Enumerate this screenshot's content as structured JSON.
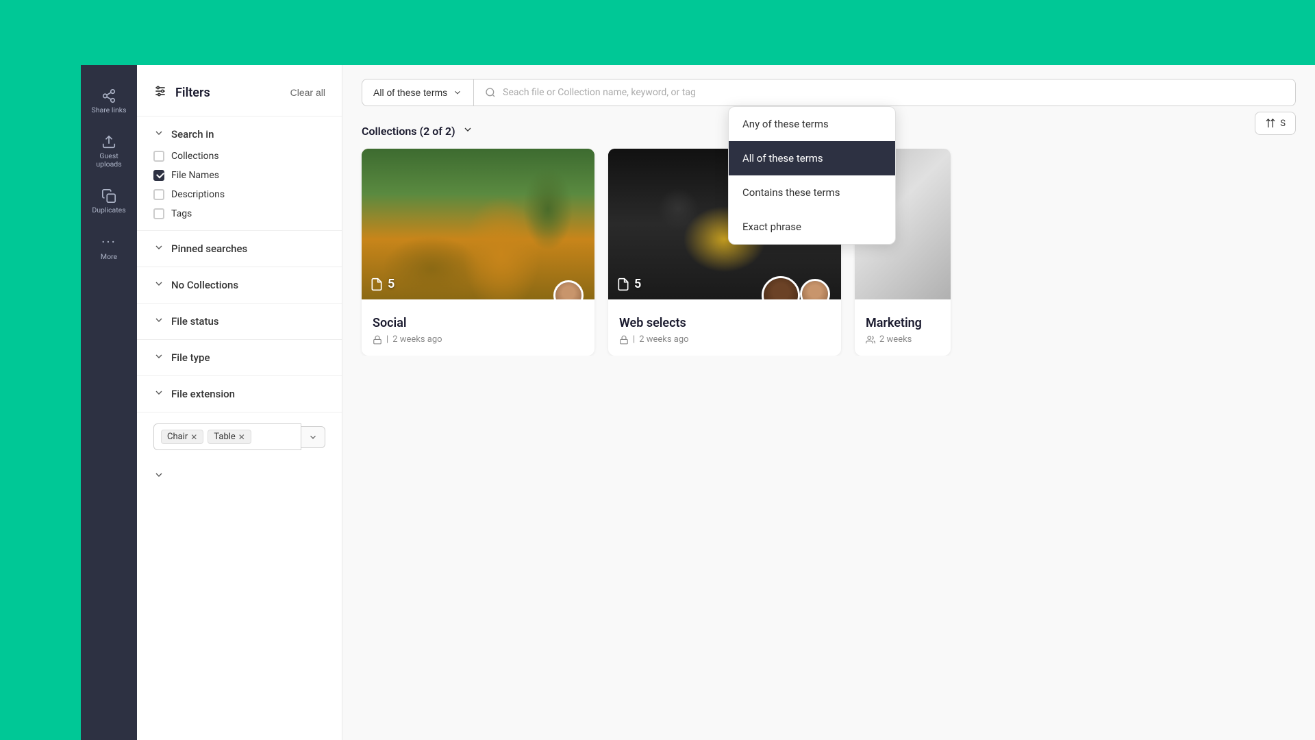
{
  "app": {
    "background_color": "#00c896"
  },
  "nav": {
    "items": [
      {
        "id": "share-links",
        "label": "Share links",
        "icon": "share-icon"
      },
      {
        "id": "guest-uploads",
        "label": "Guest uploads",
        "icon": "upload-icon"
      },
      {
        "id": "duplicates",
        "label": "Duplicates",
        "icon": "copy-icon"
      },
      {
        "id": "more",
        "label": "More",
        "icon": "dots-icon"
      }
    ]
  },
  "filters": {
    "title": "Filters",
    "clear_all": "Clear all",
    "sections": {
      "search_in": {
        "label": "Search in",
        "expanded": true,
        "options": [
          {
            "id": "collections",
            "label": "Collections",
            "checked": false
          },
          {
            "id": "file-names",
            "label": "File Names",
            "checked": true
          },
          {
            "id": "descriptions",
            "label": "Descriptions",
            "checked": false
          },
          {
            "id": "tags",
            "label": "Tags",
            "checked": false
          }
        ]
      },
      "pinned_searches": {
        "label": "Pinned searches",
        "expanded": false
      },
      "no_collections": {
        "label": "No Collections",
        "expanded": false
      },
      "file_status": {
        "label": "File status",
        "expanded": false
      },
      "file_type": {
        "label": "File type",
        "expanded": false
      },
      "file_extension": {
        "label": "File extension",
        "expanded": false
      }
    },
    "tags": [
      {
        "label": "Chair"
      },
      {
        "label": "Table"
      }
    ]
  },
  "search": {
    "type_label": "All of these terms",
    "placeholder": "Seach file or Collection name, keyword, or tag"
  },
  "dropdown": {
    "items": [
      {
        "id": "any",
        "label": "Any of these terms",
        "active": false
      },
      {
        "id": "all",
        "label": "All of these terms",
        "active": true
      },
      {
        "id": "contains",
        "label": "Contains these terms",
        "active": false
      },
      {
        "id": "exact",
        "label": "Exact phrase",
        "active": false
      }
    ]
  },
  "collections": {
    "heading": "Collections (2 of 2)",
    "items": [
      {
        "id": "social",
        "name": "Social",
        "file_count": "5",
        "time_ago": "2 weeks ago",
        "locked": true,
        "shared": false
      },
      {
        "id": "web-selects",
        "name": "Web selects",
        "file_count": "5",
        "time_ago": "2 weeks ago",
        "locked": true,
        "shared": false
      },
      {
        "id": "marketing",
        "name": "Marketing",
        "file_count": "",
        "time_ago": "2 weeks",
        "locked": false,
        "shared": true
      }
    ]
  },
  "sort": {
    "label": "S"
  }
}
